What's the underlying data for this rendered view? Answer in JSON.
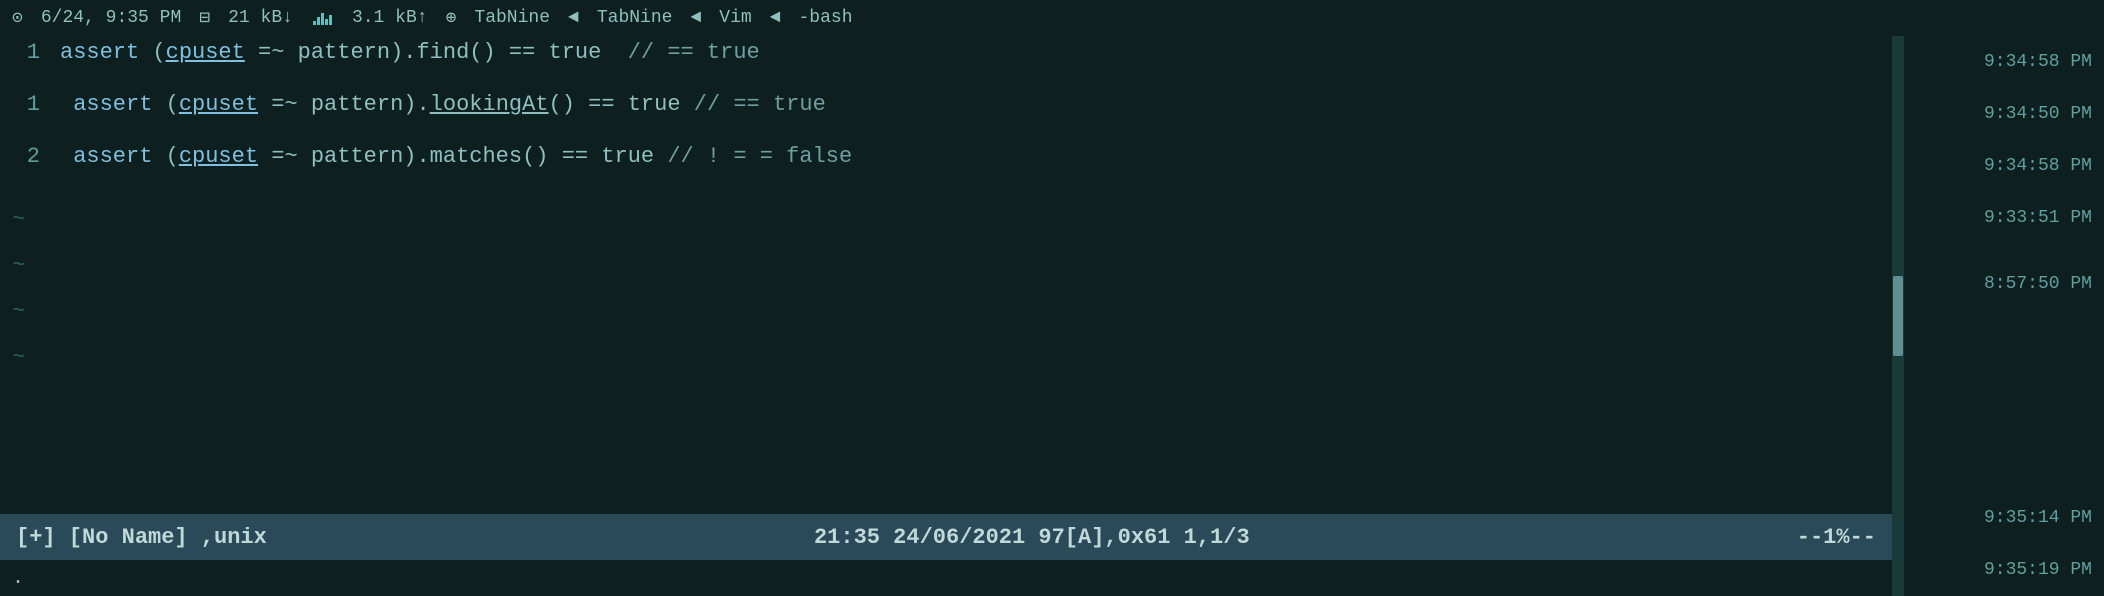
{
  "topbar": {
    "clock_icon": "⊙",
    "datetime": "6/24, 9:35 PM",
    "network_icon": "⊟",
    "download": "21 kB↓",
    "upload": "3.1 kB↑",
    "tabnine_icon": "⊕",
    "tabnine1": "TabNine",
    "arrow1": "◄",
    "tabnine2": "TabNine",
    "arrow2": "◄",
    "vim": "Vim",
    "arrow3": "◄",
    "bash": "-bash"
  },
  "editor": {
    "lines": [
      {
        "number": "1",
        "parts": [
          {
            "text": "assert",
            "class": "kw-assert"
          },
          {
            "text": " ("
          },
          {
            "text": "cpuset",
            "class": "kw-cpuset"
          },
          {
            "text": " =~ pattern).find() == true  // == true",
            "class": ""
          }
        ]
      },
      {
        "number": "1",
        "parts": [
          {
            "text": "assert",
            "class": "kw-assert"
          },
          {
            "text": " ("
          },
          {
            "text": "cpuset",
            "class": "kw-cpuset"
          },
          {
            "text": " =~ pattern)."
          },
          {
            "text": "lookingAt()",
            "class": "kw-method-underline"
          },
          {
            "text": " == true // == true",
            "class": ""
          }
        ]
      },
      {
        "number": "2",
        "parts": [
          {
            "text": "assert",
            "class": "kw-assert"
          },
          {
            "text": " ("
          },
          {
            "text": "cpuset",
            "class": "kw-cpuset"
          },
          {
            "text": " =~ pattern).matches() == true // ! = = false",
            "class": ""
          }
        ]
      }
    ],
    "tildes": [
      "~",
      "~",
      "~",
      "~"
    ]
  },
  "statusline": {
    "left": "[+]  [No Name]  ,unix",
    "center": "21:35  24/06/2021  97[A],0x61  1,1/3",
    "right": "--1%--"
  },
  "cmdline": {
    "text": "."
  },
  "timestamps": {
    "right_col": [
      "9:34:58 PM",
      "9:34:50 PM",
      "9:34:58 PM",
      "9:33:51 PM",
      "8:57:50 PM",
      "",
      "",
      "9:35:14 PM",
      "9:35:19 PM"
    ]
  }
}
